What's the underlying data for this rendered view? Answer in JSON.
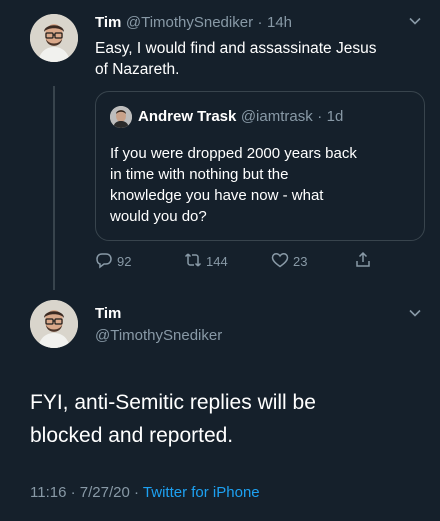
{
  "tweet1": {
    "author_name": "Tim",
    "handle": "@TimothySnediker",
    "separator": "·",
    "time": "14h",
    "text_line1": "Easy, I would find and assassinate Jesus",
    "text_line2": "of Nazareth."
  },
  "quoted": {
    "author_name": "Andrew Trask",
    "handle": "@iamtrask",
    "separator": "·",
    "time": "1d",
    "lines": [
      "If you were dropped 2000 years back",
      "in time with nothing but the",
      "knowledge you have now - what",
      "would you do?"
    ]
  },
  "actions": {
    "replies": "92",
    "retweets": "144",
    "likes": "23"
  },
  "tweet2": {
    "author_name": "Tim",
    "handle": "@TimothySnediker",
    "text_line1": "FYI, anti-Semitic replies will be",
    "text_line2": "blocked and reported.",
    "time": "11:16",
    "sep1": "·",
    "date": "7/27/20",
    "sep2": "·",
    "source": "Twitter for iPhone"
  },
  "colors": {
    "background": "#15202b",
    "muted": "#8899a6",
    "accent": "#1da1f2",
    "border": "#38444d"
  },
  "icons": [
    "chevron-down-icon",
    "reply-icon",
    "retweet-icon",
    "like-icon",
    "share-icon"
  ]
}
